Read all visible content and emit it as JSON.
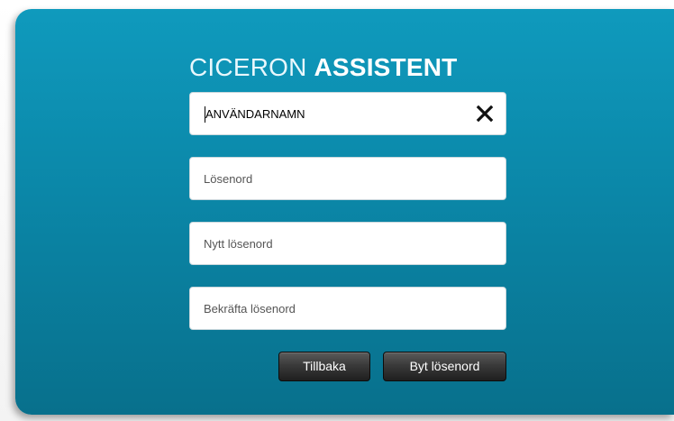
{
  "title": {
    "light": "CICERON",
    "bold": "ASSISTENT"
  },
  "fields": {
    "username": {
      "value": "ANVÄNDARNAMN",
      "clear_icon": "close-x"
    },
    "password": {
      "placeholder": "Lösenord"
    },
    "new_password": {
      "placeholder": "Nytt lösenord"
    },
    "confirm_password": {
      "placeholder": "Bekräfta lösenord"
    }
  },
  "buttons": {
    "back": "Tillbaka",
    "change_password": "Byt lösenord"
  },
  "colors": {
    "panel_top": "#0f9abd",
    "panel_bottom": "#08708c",
    "button_dark": "#2e2e2e"
  }
}
